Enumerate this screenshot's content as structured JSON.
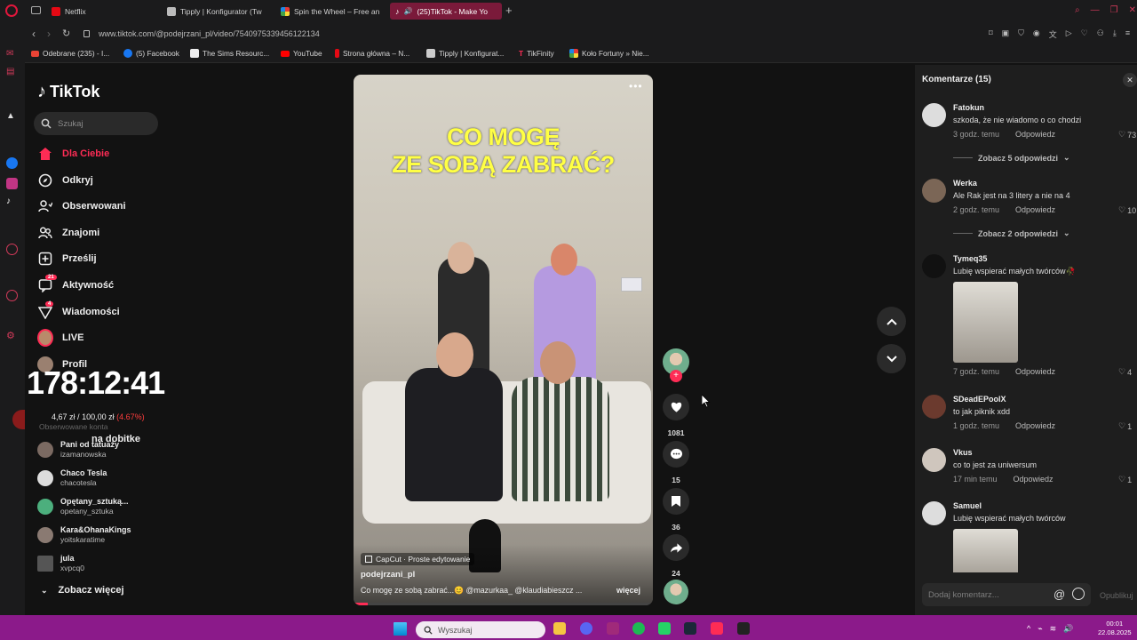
{
  "browser": {
    "tabs": [
      {
        "title": "Netflix",
        "icon_color": "#e50914",
        "active": false
      },
      {
        "title": "Tipply | Konfigurator (Tw",
        "icon_color": "#bbbbbb",
        "active": false
      },
      {
        "title": "Spin the Wheel – Free an",
        "icon_color": "#7e57c2",
        "active": false
      },
      {
        "title": "(25)TikTok - Make Yo",
        "icon_color": "#ffffff",
        "active": true
      }
    ],
    "url": "www.tiktok.com/@podejrzani_pl/video/7540975339456122134",
    "bookmarks": [
      "Odebrane (235) - I...",
      "(5) Facebook",
      "The Sims Resourc...",
      "YouTube",
      "Strona główna – N...",
      "Tipply | Konfigurat...",
      "TikFinity",
      "Koło Fortuny » Nie..."
    ]
  },
  "tiktok": {
    "logo": "TikTok",
    "search_placeholder": "Szukaj",
    "nav": [
      {
        "label": "Dla Ciebie",
        "icon": "home-icon",
        "active": true
      },
      {
        "label": "Odkryj",
        "icon": "compass-icon"
      },
      {
        "label": "Obserwowani",
        "icon": "following-icon"
      },
      {
        "label": "Znajomi",
        "icon": "friends-icon"
      },
      {
        "label": "Prześlij",
        "icon": "upload-icon"
      },
      {
        "label": "Aktywność",
        "icon": "activity-icon",
        "badge": "21"
      },
      {
        "label": "Wiadomości",
        "icon": "messages-icon",
        "badge": "4"
      },
      {
        "label": "LIVE",
        "icon": "live-icon"
      },
      {
        "label": "Profil",
        "icon": "profile-icon"
      }
    ],
    "overlay": {
      "timer": "178:12:41",
      "donation_current": "4,67 zł",
      "donation_separator": "/",
      "donation_goal": "100,00 zł",
      "donation_pct": "(4.67%)",
      "donation_progress_pct": 4.67,
      "donation_label": "na dobitke"
    },
    "following_header": "Obserwowane konta",
    "following": [
      {
        "name": "Pani od tatuaży",
        "handle": "izamanowska"
      },
      {
        "name": "Chaco Tesla",
        "handle": "chacotesla"
      },
      {
        "name": "Opętany_sztuką...",
        "handle": "opetany_sztuka"
      },
      {
        "name": "Kara&OhanaKings",
        "handle": "yoitskaratime"
      },
      {
        "name": "jula",
        "handle": "xvpcq0"
      }
    ],
    "see_more": "Zobacz więcej"
  },
  "video": {
    "title_line1": "CO MOGĘ",
    "title_line2": "ZE SOBĄ ZABRAĆ?",
    "capcut": "CapCut · Proste edytowanie",
    "author": "podejrzani_pl",
    "description": "Co mogę ze sobą zabrać...😊 @mazurkaa_ @klaudiabieszcz ...",
    "more": "więcej",
    "likes": "1081",
    "comments": "15",
    "saves": "36",
    "shares": "24"
  },
  "comments_panel": {
    "title": "Komentarze (15)",
    "reply_label": "Odpowiedz",
    "items": [
      {
        "user": "Fatokun",
        "text": "szkoda, że nie wiadomo o co chodzi",
        "time": "3 godz. temu",
        "likes": "73",
        "replies": "Zobacz 5 odpowiedzi"
      },
      {
        "user": "Werka",
        "text": "Ale Rak jest na 3 litery a nie na 4",
        "time": "2 godz. temu",
        "likes": "10",
        "replies": "Zobacz 2 odpowiedzi"
      },
      {
        "user": "Tymeq35",
        "text": "Lubię wspierać małych twórców🥀",
        "time": "7 godz. temu",
        "likes": "4"
      },
      {
        "user": "SDeadEPoolX",
        "text": "to jak piknik xdd",
        "time": "1 godz. temu",
        "likes": "1"
      },
      {
        "user": "Vkus",
        "text": "co to jest za uniwersum",
        "time": "17 min temu",
        "likes": "1"
      },
      {
        "user": "Samuel",
        "text": "Lubię wspierać małych twórców",
        "time": ""
      }
    ],
    "input_placeholder": "Dodaj komentarz...",
    "publish": "Opublikuj"
  },
  "taskbar": {
    "search_placeholder": "Wyszukaj",
    "time": "00:01",
    "date": "22.08.2025"
  }
}
